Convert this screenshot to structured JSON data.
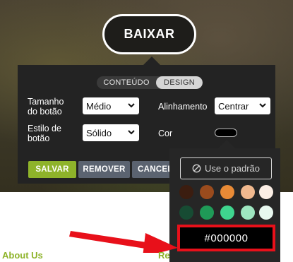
{
  "hero": {
    "button_label": "BAIXAR"
  },
  "panel": {
    "tabs": [
      {
        "label": "CONTEÚDO",
        "active": false
      },
      {
        "label": "DESIGN",
        "active": true
      }
    ],
    "size": {
      "label_line1": "Tamanho",
      "label_line2": "do botão",
      "value": "Médio"
    },
    "style": {
      "label_line1": "Estilo de",
      "label_line2": "botão",
      "value": "Sólido"
    },
    "alignment": {
      "label": "Alinhamento",
      "value": "Centrar"
    },
    "color": {
      "label": "Cor",
      "value": "#000000"
    },
    "actions": {
      "save": "SALVAR",
      "remove": "REMOVER",
      "cancel": "CANCELAR"
    }
  },
  "color_picker": {
    "default_label": "Use o padrão",
    "swatches_row1": [
      "#3b1d10",
      "#9a4b1d",
      "#e88a36",
      "#f1b98f",
      "#fbeee5"
    ],
    "swatches_row2": [
      "#174b33",
      "#1f9a57",
      "#3fd58e",
      "#9ee6c0",
      "#e8f8ef"
    ],
    "hex_value": "#000000"
  },
  "footer": {
    "about": "About Us",
    "right_partial": "Re"
  },
  "colors": {
    "accent_green": "#8eb32a",
    "panel_bg": "#232323",
    "highlight_red": "#e8101a"
  }
}
